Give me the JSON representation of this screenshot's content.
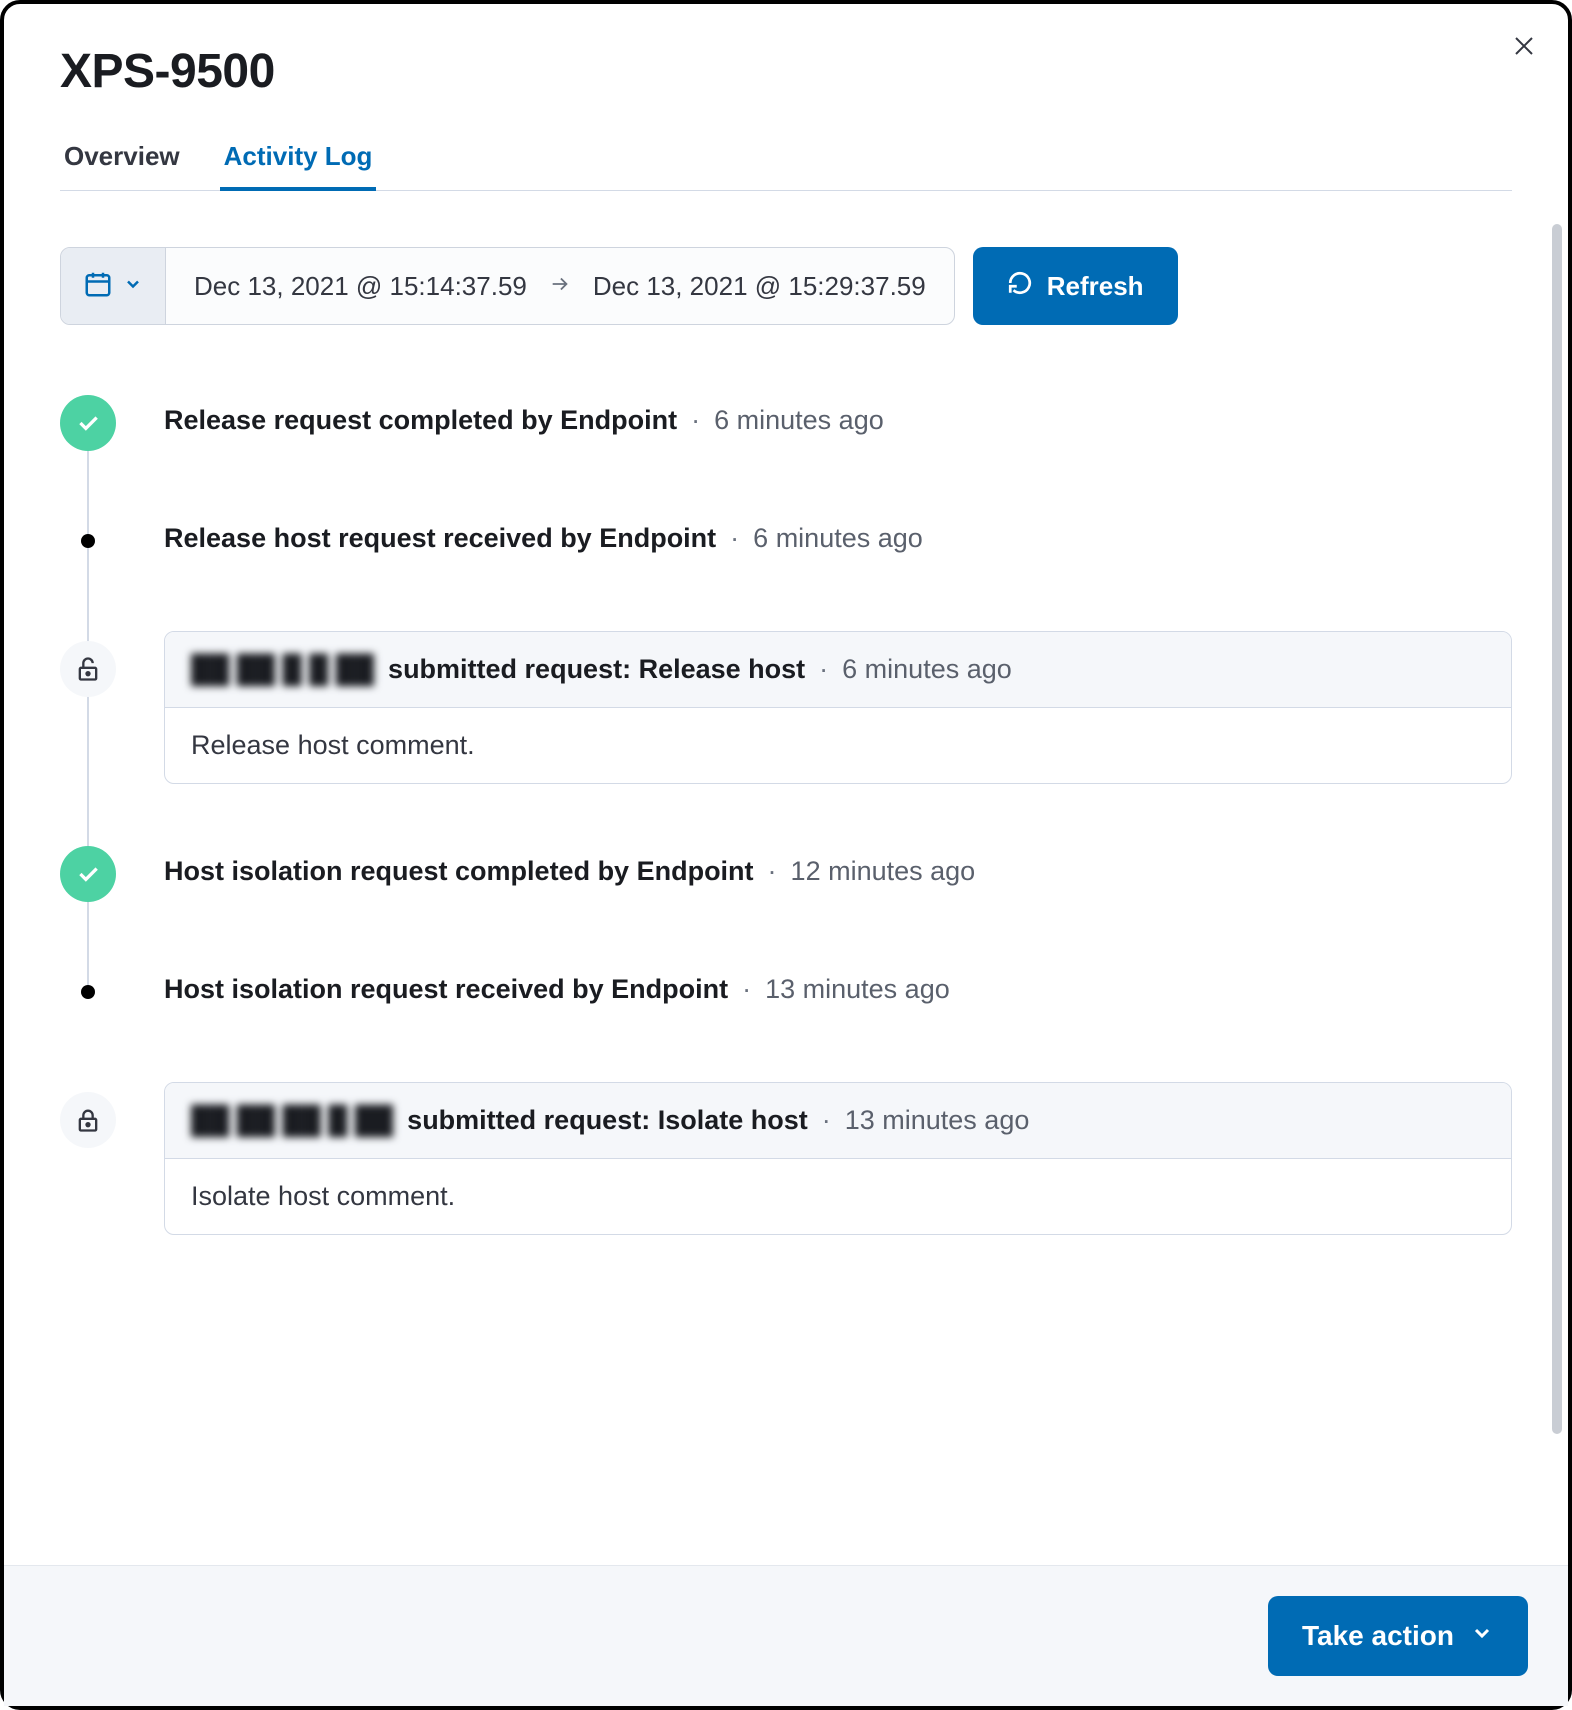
{
  "header": {
    "title": "XPS-9500",
    "tabs": [
      {
        "label": "Overview",
        "active": false
      },
      {
        "label": "Activity Log",
        "active": true
      }
    ]
  },
  "controls": {
    "date_from": "Dec 13, 2021 @ 15:14:37.59",
    "date_to": "Dec 13, 2021 @ 15:29:37.59",
    "refresh_label": "Refresh"
  },
  "events": [
    {
      "type": "check",
      "title": "Release request completed by Endpoint",
      "time": "6 minutes ago"
    },
    {
      "type": "dot",
      "title": "Release host request received by Endpoint",
      "time": "6 minutes ago"
    },
    {
      "type": "card",
      "icon": "unlock",
      "user": "██ ██ █ █ ██",
      "action": "submitted request: Release host",
      "time": "6 minutes ago",
      "comment": "Release host comment."
    },
    {
      "type": "check",
      "title": "Host isolation request completed by Endpoint",
      "time": "12 minutes ago"
    },
    {
      "type": "dot",
      "title": "Host isolation request received by Endpoint",
      "time": "13 minutes ago"
    },
    {
      "type": "card",
      "icon": "lock",
      "user": "██ ██ ██ █ ██",
      "action": "submitted request: Isolate host",
      "time": "13 minutes ago",
      "comment": "Isolate host comment."
    }
  ],
  "footer": {
    "take_action_label": "Take action"
  },
  "sep": "·"
}
